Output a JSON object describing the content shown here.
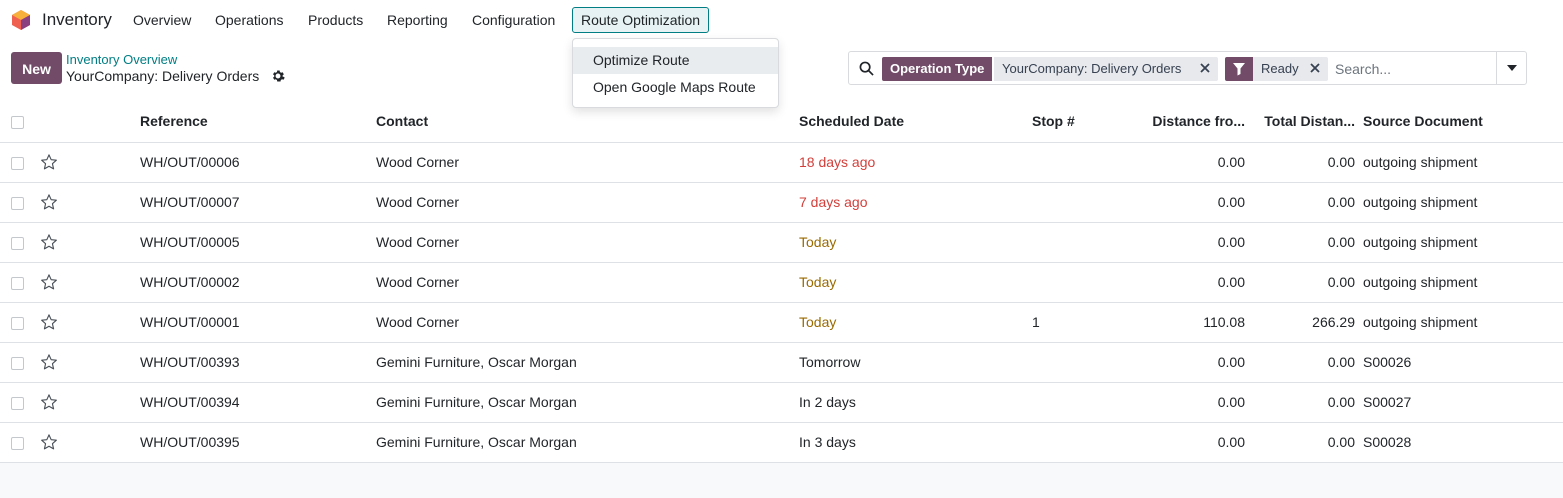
{
  "app": {
    "name": "Inventory"
  },
  "nav": {
    "items": [
      "Overview",
      "Operations",
      "Products",
      "Reporting",
      "Configuration"
    ],
    "active": "Route Optimization"
  },
  "dropdown": {
    "items": [
      "Optimize Route",
      "Open Google Maps Route"
    ]
  },
  "control": {
    "new_label": "New",
    "breadcrumb_parent": "Inventory Overview",
    "breadcrumb_current": "YourCompany: Delivery Orders"
  },
  "search": {
    "facet1_label": "Operation Type",
    "facet1_value": "YourCompany: Delivery Orders",
    "facet2_value": "Ready",
    "placeholder": "Search..."
  },
  "table": {
    "columns": [
      "Reference",
      "Contact",
      "Scheduled Date",
      "Stop #",
      "Distance fro...",
      "Total Distan...",
      "Source Document"
    ],
    "rows": [
      {
        "reference": "WH/OUT/00006",
        "contact": "Wood Corner",
        "date": "18 days ago",
        "date_status": "overdue",
        "stop": "",
        "distance": "0.00",
        "total": "0.00",
        "source": "outgoing shipment"
      },
      {
        "reference": "WH/OUT/00007",
        "contact": "Wood Corner",
        "date": "7 days ago",
        "date_status": "overdue",
        "stop": "",
        "distance": "0.00",
        "total": "0.00",
        "source": "outgoing shipment"
      },
      {
        "reference": "WH/OUT/00005",
        "contact": "Wood Corner",
        "date": "Today",
        "date_status": "today",
        "stop": "",
        "distance": "0.00",
        "total": "0.00",
        "source": "outgoing shipment"
      },
      {
        "reference": "WH/OUT/00002",
        "contact": "Wood Corner",
        "date": "Today",
        "date_status": "today",
        "stop": "",
        "distance": "0.00",
        "total": "0.00",
        "source": "outgoing shipment"
      },
      {
        "reference": "WH/OUT/00001",
        "contact": "Wood Corner",
        "date": "Today",
        "date_status": "today",
        "stop": "1",
        "distance": "110.08",
        "total": "266.29",
        "source": "outgoing shipment"
      },
      {
        "reference": "WH/OUT/00393",
        "contact": "Gemini Furniture, Oscar Morgan",
        "date": "Tomorrow",
        "date_status": "normal",
        "stop": "",
        "distance": "0.00",
        "total": "0.00",
        "source": "S00026"
      },
      {
        "reference": "WH/OUT/00394",
        "contact": "Gemini Furniture, Oscar Morgan",
        "date": "In 2 days",
        "date_status": "normal",
        "stop": "",
        "distance": "0.00",
        "total": "0.00",
        "source": "S00027"
      },
      {
        "reference": "WH/OUT/00395",
        "contact": "Gemini Furniture, Oscar Morgan",
        "date": "In 3 days",
        "date_status": "normal",
        "stop": "",
        "distance": "0.00",
        "total": "0.00",
        "source": "S00028"
      }
    ]
  },
  "colors": {
    "brand": "#714b67",
    "link": "#017e84",
    "overdue": "#d23f3a",
    "today": "#9a6a00"
  }
}
